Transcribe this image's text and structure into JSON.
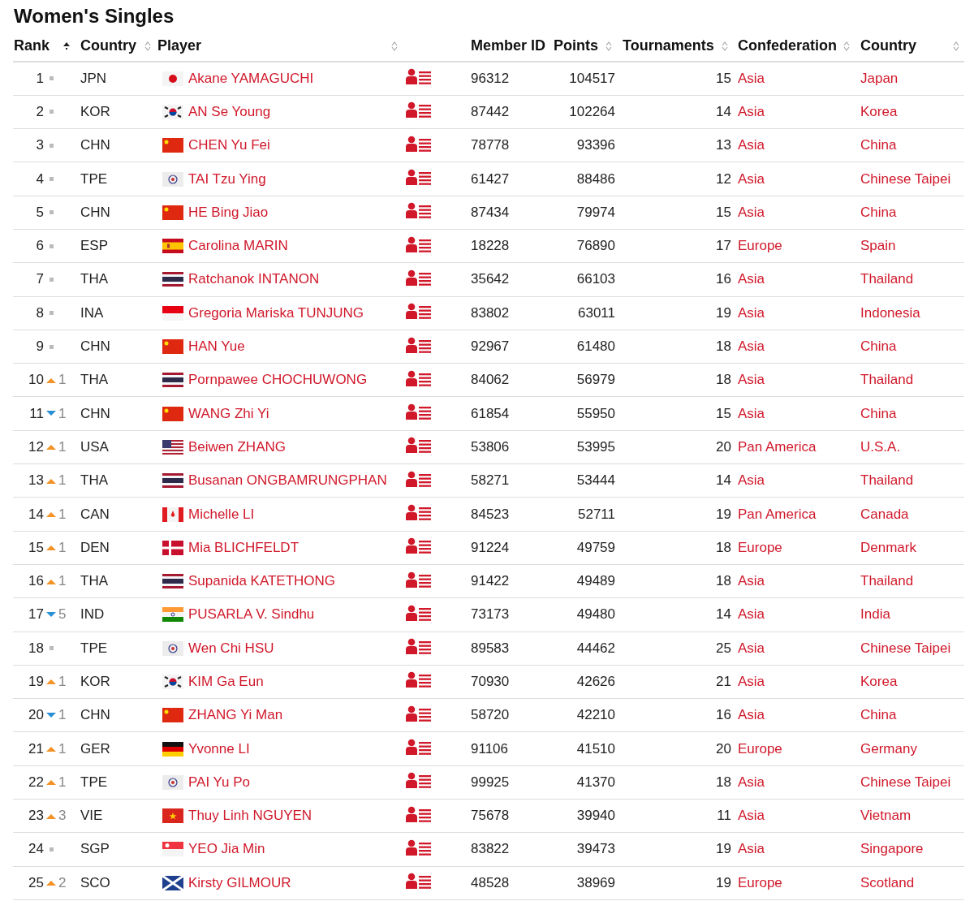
{
  "title": "Women's Singles",
  "columns": [
    {
      "label": "Rank",
      "sorted": true
    },
    {
      "label": "Country",
      "sorted": false
    },
    {
      "label": "Player",
      "sorted": false
    },
    {},
    {
      "label": "Member ID"
    },
    {
      "label": "Points",
      "sorted": false
    },
    {
      "label": "Tournaments",
      "sorted": false
    },
    {
      "label": "Confederation",
      "sorted": false
    },
    {
      "label": "Country",
      "sorted": false
    }
  ],
  "rows": [
    {
      "rank": "1",
      "kind": "same",
      "code": "JPN",
      "player": "Akane YAMAGUCHI",
      "member_id": "96312",
      "points": "104517",
      "tournaments": "15",
      "confederation": "Asia",
      "country": "Japan"
    },
    {
      "rank": "2",
      "kind": "same",
      "code": "KOR",
      "player": "AN Se Young",
      "member_id": "87442",
      "points": "102264",
      "tournaments": "14",
      "confederation": "Asia",
      "country": "Korea"
    },
    {
      "rank": "3",
      "kind": "same",
      "code": "CHN",
      "player": "CHEN Yu Fei",
      "member_id": "78778",
      "points": "93396",
      "tournaments": "13",
      "confederation": "Asia",
      "country": "China"
    },
    {
      "rank": "4",
      "kind": "same",
      "code": "TPE",
      "player": "TAI Tzu Ying",
      "member_id": "61427",
      "points": "88486",
      "tournaments": "12",
      "confederation": "Asia",
      "country": "Chinese Taipei"
    },
    {
      "rank": "5",
      "kind": "same",
      "code": "CHN",
      "player": "HE Bing Jiao",
      "member_id": "87434",
      "points": "79974",
      "tournaments": "15",
      "confederation": "Asia",
      "country": "China"
    },
    {
      "rank": "6",
      "kind": "same",
      "code": "ESP",
      "player": "Carolina MARIN",
      "member_id": "18228",
      "points": "76890",
      "tournaments": "17",
      "confederation": "Europe",
      "country": "Spain"
    },
    {
      "rank": "7",
      "kind": "same",
      "code": "THA",
      "player": "Ratchanok INTANON",
      "member_id": "35642",
      "points": "66103",
      "tournaments": "16",
      "confederation": "Asia",
      "country": "Thailand"
    },
    {
      "rank": "8",
      "kind": "same",
      "code": "INA",
      "player": "Gregoria Mariska TUNJUNG",
      "member_id": "83802",
      "points": "63011",
      "tournaments": "19",
      "confederation": "Asia",
      "country": "Indonesia"
    },
    {
      "rank": "9",
      "kind": "same",
      "code": "CHN",
      "player": "HAN Yue",
      "member_id": "92967",
      "points": "61480",
      "tournaments": "18",
      "confederation": "Asia",
      "country": "China"
    },
    {
      "rank": "10",
      "kind": "up",
      "change": "1",
      "code": "THA",
      "player": "Pornpawee CHOCHUWONG",
      "member_id": "84062",
      "points": "56979",
      "tournaments": "18",
      "confederation": "Asia",
      "country": "Thailand"
    },
    {
      "rank": "11",
      "kind": "down",
      "change": "1",
      "code": "CHN",
      "player": "WANG Zhi Yi",
      "member_id": "61854",
      "points": "55950",
      "tournaments": "15",
      "confederation": "Asia",
      "country": "China"
    },
    {
      "rank": "12",
      "kind": "up",
      "change": "1",
      "code": "USA",
      "player": "Beiwen ZHANG",
      "member_id": "53806",
      "points": "53995",
      "tournaments": "20",
      "confederation": "Pan America",
      "country": "U.S.A."
    },
    {
      "rank": "13",
      "kind": "up",
      "change": "1",
      "code": "THA",
      "player": "Busanan ONGBAMRUNGPHAN",
      "member_id": "58271",
      "points": "53444",
      "tournaments": "14",
      "confederation": "Asia",
      "country": "Thailand"
    },
    {
      "rank": "14",
      "kind": "up",
      "change": "1",
      "code": "CAN",
      "player": "Michelle LI",
      "member_id": "84523",
      "points": "52711",
      "tournaments": "19",
      "confederation": "Pan America",
      "country": "Canada"
    },
    {
      "rank": "15",
      "kind": "up",
      "change": "1",
      "code": "DEN",
      "player": "Mia BLICHFELDT",
      "member_id": "91224",
      "points": "49759",
      "tournaments": "18",
      "confederation": "Europe",
      "country": "Denmark"
    },
    {
      "rank": "16",
      "kind": "up",
      "change": "1",
      "code": "THA",
      "player": "Supanida KATETHONG",
      "member_id": "91422",
      "points": "49489",
      "tournaments": "18",
      "confederation": "Asia",
      "country": "Thailand"
    },
    {
      "rank": "17",
      "kind": "down",
      "change": "5",
      "code": "IND",
      "player": "PUSARLA V. Sindhu",
      "member_id": "73173",
      "points": "49480",
      "tournaments": "14",
      "confederation": "Asia",
      "country": "India"
    },
    {
      "rank": "18",
      "kind": "same",
      "code": "TPE",
      "player": "Wen Chi HSU",
      "member_id": "89583",
      "points": "44462",
      "tournaments": "25",
      "confederation": "Asia",
      "country": "Chinese Taipei"
    },
    {
      "rank": "19",
      "kind": "up",
      "change": "1",
      "code": "KOR",
      "player": "KIM Ga Eun",
      "member_id": "70930",
      "points": "42626",
      "tournaments": "21",
      "confederation": "Asia",
      "country": "Korea"
    },
    {
      "rank": "20",
      "kind": "down",
      "change": "1",
      "code": "CHN",
      "player": "ZHANG Yi Man",
      "member_id": "58720",
      "points": "42210",
      "tournaments": "16",
      "confederation": "Asia",
      "country": "China"
    },
    {
      "rank": "21",
      "kind": "up",
      "change": "1",
      "code": "GER",
      "player": "Yvonne LI",
      "member_id": "91106",
      "points": "41510",
      "tournaments": "20",
      "confederation": "Europe",
      "country": "Germany"
    },
    {
      "rank": "22",
      "kind": "up",
      "change": "1",
      "code": "TPE",
      "player": "PAI Yu Po",
      "member_id": "99925",
      "points": "41370",
      "tournaments": "18",
      "confederation": "Asia",
      "country": "Chinese Taipei"
    },
    {
      "rank": "23",
      "kind": "up",
      "change": "3",
      "code": "VIE",
      "player": "Thuy Linh NGUYEN",
      "member_id": "75678",
      "points": "39940",
      "tournaments": "11",
      "confederation": "Asia",
      "country": "Vietnam"
    },
    {
      "rank": "24",
      "kind": "same",
      "code": "SGP",
      "player": "YEO Jia Min",
      "member_id": "83822",
      "points": "39473",
      "tournaments": "19",
      "confederation": "Asia",
      "country": "Singapore"
    },
    {
      "rank": "25",
      "kind": "up",
      "change": "2",
      "code": "SCO",
      "player": "Kirsty GILMOUR",
      "member_id": "48528",
      "points": "38969",
      "tournaments": "19",
      "confederation": "Europe",
      "country": "Scotland"
    }
  ]
}
